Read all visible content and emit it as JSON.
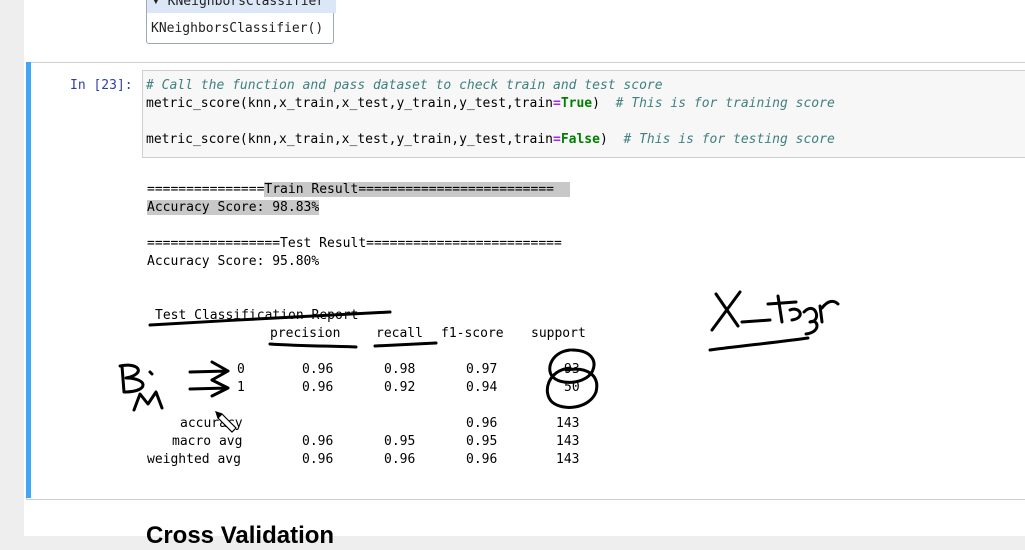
{
  "prev_cell": {
    "prompt": "",
    "collapsed_label": "▾ KNeighborsClassifier",
    "repr": "KNeighborsClassifier()"
  },
  "cell": {
    "prompt": "In [23]:",
    "code": {
      "line1": "# Call the function and pass dataset to check train and test score",
      "line2_code": "metric_score(knn,x_train,x_test,y_train,y_test,train",
      "line2_eq": "=",
      "line2_kw": "True",
      "line2_close": ")  ",
      "line2_comment": "# This is for training score",
      "line3_code": "metric_score(knn,x_train,x_test,y_train,y_test,train",
      "line3_eq": "=",
      "line3_kw": "False",
      "line3_close": ")  ",
      "line3_comment": "# This is for testing score"
    },
    "output": {
      "train_header_pre": "===============",
      "train_header_hl": "Train Result=========================  ",
      "train_acc": "Accuracy Score: 98.83%",
      "test_header": "=================Test Result=========================",
      "test_acc": "Accuracy Score: 95.80%",
      "report_title": "Test Classification Report",
      "report": {
        "headers": [
          "precision",
          "recall",
          "f1-score",
          "support"
        ],
        "rows": [
          {
            "label": "0",
            "precision": "0.96",
            "recall": "0.98",
            "f1": "0.97",
            "support": "93"
          },
          {
            "label": "1",
            "precision": "0.96",
            "recall": "0.92",
            "f1": "0.94",
            "support": "50"
          },
          {
            "label": "accuracy",
            "precision": "",
            "recall": "",
            "f1": "0.96",
            "support": "143"
          },
          {
            "label": "macro avg",
            "precision": "0.96",
            "recall": "0.95",
            "f1": "0.95",
            "support": "143"
          },
          {
            "label": "weighted avg",
            "precision": "0.96",
            "recall": "0.96",
            "f1": "0.96",
            "support": "143"
          }
        ]
      }
    }
  },
  "next_heading": "Cross Validation",
  "colors": {
    "cell_bar": "#42a5f5",
    "prompt": "#303f9f",
    "comment": "#408080",
    "keyword": "#008000",
    "operator": "#aa22ff"
  }
}
